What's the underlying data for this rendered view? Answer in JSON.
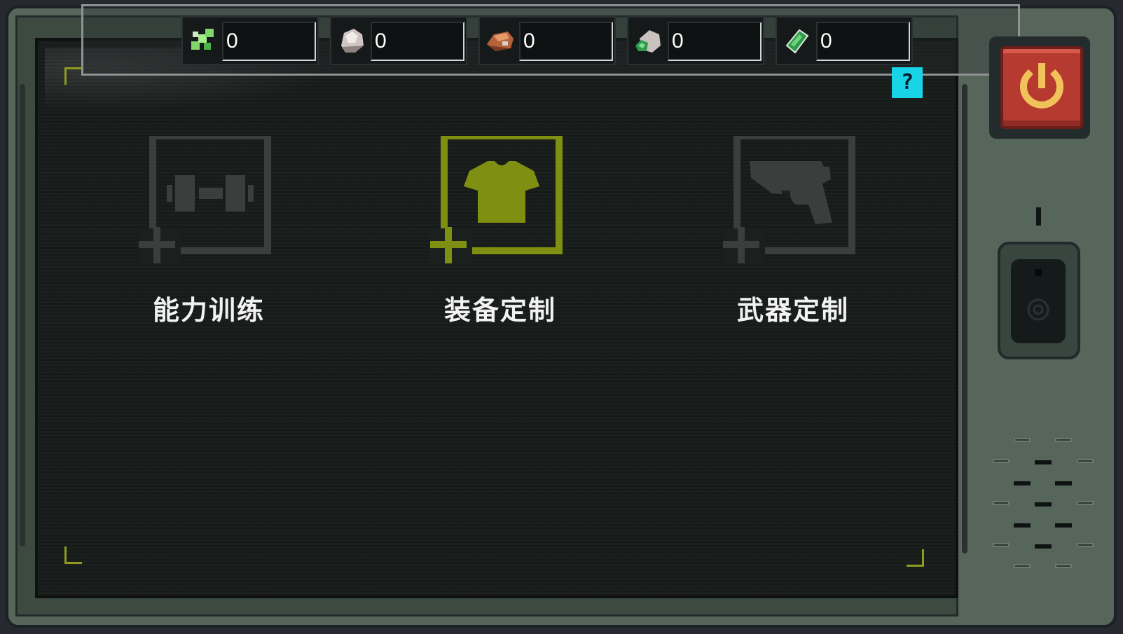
{
  "resources": [
    {
      "name": "green-crystal-icon",
      "count": "0"
    },
    {
      "name": "white-ore-icon",
      "count": "0"
    },
    {
      "name": "copper-ore-icon",
      "count": "0"
    },
    {
      "name": "green-ore-icon",
      "count": "0"
    },
    {
      "name": "emerald-gem-icon",
      "count": "0"
    }
  ],
  "help": {
    "label": "?"
  },
  "menu": [
    {
      "id": "ability-training",
      "label": "能力训练",
      "icon": "dumbbell-icon",
      "state": "inactive"
    },
    {
      "id": "equipment-custom",
      "label": "装备定制",
      "icon": "shirt-icon",
      "state": "selected"
    },
    {
      "id": "weapon-custom",
      "label": "武器定制",
      "icon": "pistol-icon",
      "state": "inactive"
    }
  ],
  "colors": {
    "accent": "#7f8f12",
    "inactive": "#3a3f3d",
    "frame": "#56665a",
    "screen": "#1b1f1d",
    "power": "#b63a30",
    "power_symbol": "#f2c25a",
    "help": "#17d4e6"
  }
}
